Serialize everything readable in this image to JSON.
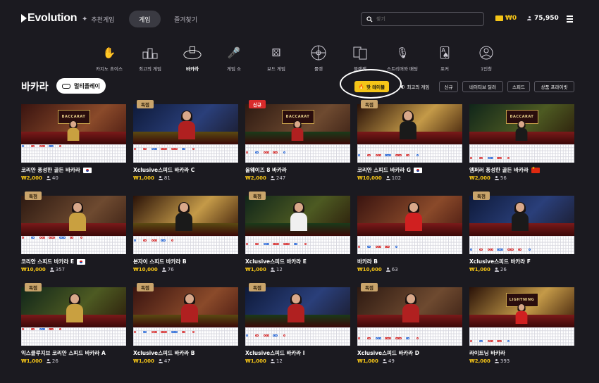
{
  "header": {
    "logo": "Evolution",
    "nav": [
      {
        "label": "추천게임",
        "icon": "sparkle-icon"
      },
      {
        "label": "게임",
        "active": true
      },
      {
        "label": "즐겨찾기"
      }
    ],
    "search_placeholder": "찾기",
    "wallet": "₩0",
    "balance": "75,950"
  },
  "categories": [
    {
      "label": "카지노 초이스",
      "icon": "hands-icon"
    },
    {
      "label": "최고의 게임",
      "icon": "podium-icon"
    },
    {
      "label": "바카라",
      "icon": "player-banker-icon",
      "active": true
    },
    {
      "label": "게임 쇼",
      "icon": "microphone-icon"
    },
    {
      "label": "보드 게임",
      "icon": "dice-icon"
    },
    {
      "label": "룰렛",
      "icon": "roulette-icon"
    },
    {
      "label": "블랙잭",
      "icon": "cards-icon"
    },
    {
      "label": "스트리머와 배팅",
      "icon": "streamer-icon"
    },
    {
      "label": "포커",
      "icon": "poker-icon"
    },
    {
      "label": "1인칭",
      "icon": "first-person-icon"
    }
  ],
  "section": {
    "title": "바카라",
    "multiplay_label": "멀티플레이"
  },
  "filters": [
    {
      "label": "핫 테이블",
      "icon": "fire-icon",
      "active": true
    },
    {
      "label": "최고의 게임",
      "icon": "star-icon"
    },
    {
      "label": "신규"
    },
    {
      "label": "네이티브 딜러"
    },
    {
      "label": "스피드"
    },
    {
      "label": "상품 프라이빗"
    }
  ],
  "colors": {
    "accent": "#f5c518",
    "badge_exclusive": "#c9a46b",
    "badge_new": "#d92b2b",
    "background": "#1b1a20"
  },
  "tables": [
    {
      "title": "코리안 풍성한 골든 바카라",
      "flag": "kr",
      "bet": "₩2,000",
      "players": "40",
      "badge": "",
      "plate": "BACCARAT"
    },
    {
      "title": "Xclusive스피드 바카라 C",
      "flag": "",
      "bet": "₩1,000",
      "players": "81",
      "badge": "독점",
      "plate": ""
    },
    {
      "title": "올웨이즈 8 바카라",
      "flag": "",
      "bet": "₩2,000",
      "players": "247",
      "badge": "신규",
      "plate": "BACCARAT"
    },
    {
      "title": "코리안 스피드 바카라 G",
      "flag": "kr",
      "bet": "₩10,000",
      "players": "102",
      "badge": "독점",
      "plate": ""
    },
    {
      "title": "엠퍼러 풍성한 골든 바카라",
      "flag": "cn",
      "bet": "₩2,000",
      "players": "56",
      "badge": "",
      "plate": "BACCARAT"
    },
    {
      "title": "코리안 스피드 바카라 E",
      "flag": "kr",
      "bet": "₩10,000",
      "players": "357",
      "badge": "독점",
      "plate": ""
    },
    {
      "title": "본자이 스피드 바카라 B",
      "flag": "",
      "bet": "₩10,000",
      "players": "76",
      "badge": "",
      "plate": ""
    },
    {
      "title": "Xclusive스피드 바카라 E",
      "flag": "",
      "bet": "₩1,000",
      "players": "12",
      "badge": "독점",
      "plate": ""
    },
    {
      "title": "바카라 B",
      "flag": "",
      "bet": "₩10,000",
      "players": "63",
      "badge": "",
      "plate": ""
    },
    {
      "title": "Xclusive스피드 바카라 F",
      "flag": "",
      "bet": "₩1,000",
      "players": "26",
      "badge": "독점",
      "plate": ""
    },
    {
      "title": "익스클루지브 코리안 스피드 바카라 A",
      "flag": "",
      "bet": "₩1,000",
      "players": "26",
      "badge": "독점",
      "plate": ""
    },
    {
      "title": "Xclusive스피드 바카라 B",
      "flag": "",
      "bet": "₩1,000",
      "players": "47",
      "badge": "독점",
      "plate": ""
    },
    {
      "title": "Xclusive스피드 바카라 I",
      "flag": "",
      "bet": "₩1,000",
      "players": "12",
      "badge": "독점",
      "plate": ""
    },
    {
      "title": "Xclusive스피드 바카라 D",
      "flag": "",
      "bet": "₩1,000",
      "players": "49",
      "badge": "독점",
      "plate": ""
    },
    {
      "title": "라이트닝 바카라",
      "flag": "",
      "bet": "₩2,000",
      "players": "393",
      "badge": "",
      "plate": "LIGHTNING"
    }
  ]
}
